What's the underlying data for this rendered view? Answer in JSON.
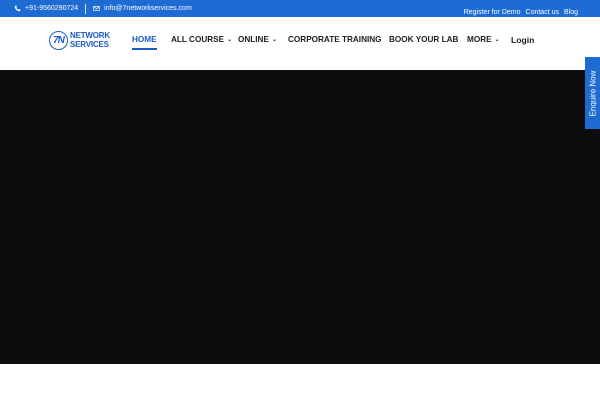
{
  "topbar": {
    "phone": "+91-9560290724",
    "email": "info@7networkservices.com",
    "links": [
      "Register for Demo",
      "Contact us",
      "Blog"
    ]
  },
  "logo": {
    "mark": "7N",
    "line1": "NETWORK",
    "line2": "SERVICES"
  },
  "nav": {
    "items": [
      {
        "label": "HOME",
        "active": true
      },
      {
        "label": "ALL COURSE",
        "dropdown": true
      },
      {
        "label": "ONLINE",
        "dropdown": true
      },
      {
        "label": "CORPORATE TRAINING"
      },
      {
        "label": "BOOK YOUR LAB"
      },
      {
        "label": "MORE",
        "dropdown": true
      },
      {
        "label": "Login"
      }
    ]
  },
  "enquire": {
    "label": "Enquire Now"
  },
  "colors": {
    "primary": "#1d6bd3",
    "logo": "#1d5bc4",
    "hero": "#0d0d0d"
  }
}
